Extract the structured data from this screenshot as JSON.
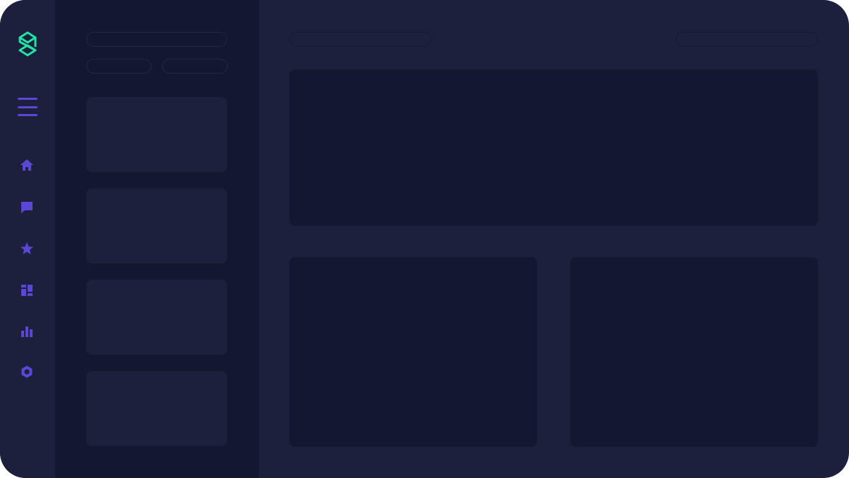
{
  "colors": {
    "background": "#1c203c",
    "panel": "#131831",
    "card": "#1c203c",
    "content_card": "#131831",
    "accent_icon": "#5a47d8",
    "logo": "#22e3a5"
  },
  "rail": {
    "logo_icon": "logo-s-icon",
    "menu_icon": "hamburger-menu-icon",
    "nav_items": [
      {
        "icon": "home-icon"
      },
      {
        "icon": "chat-icon"
      },
      {
        "icon": "star-icon"
      },
      {
        "icon": "dashboard-icon"
      },
      {
        "icon": "bar-chart-icon"
      },
      {
        "icon": "settings-icon"
      }
    ]
  },
  "panel": {
    "search": {
      "placeholder": ""
    },
    "filters": [
      "",
      ""
    ],
    "cards_count": 4
  },
  "main": {
    "left_pill": "",
    "right_pill": ""
  }
}
